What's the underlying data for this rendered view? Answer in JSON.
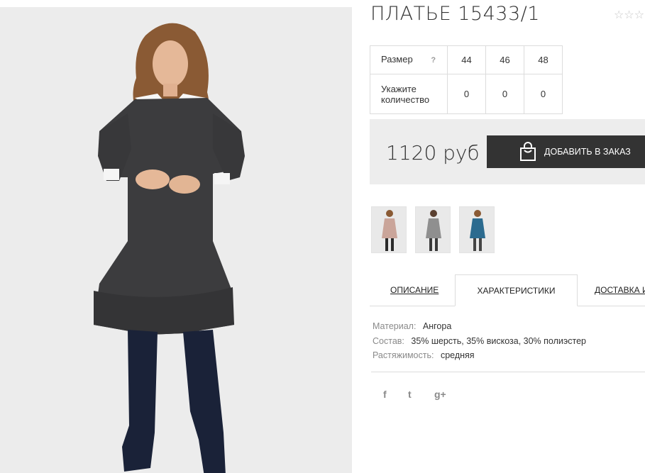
{
  "product": {
    "title": "ПЛАТЬЕ 15433/1",
    "rating_stars": "☆☆☆"
  },
  "sizes": {
    "size_label": "Размер",
    "help_label": "?",
    "qty_label_line1": "Укажите",
    "qty_label_line2": "количество",
    "options": [
      {
        "size": "44",
        "qty": "0"
      },
      {
        "size": "46",
        "qty": "0"
      },
      {
        "size": "48",
        "qty": "0"
      }
    ]
  },
  "buy": {
    "price": "1120 руб",
    "order_button_label": "ДОБАВИТЬ В ЗАКАЗ",
    "button_color": "#333333",
    "panel_color": "#ededed"
  },
  "colors_variants": [
    {
      "name": "beige",
      "color": "#caa59a"
    },
    {
      "name": "grey",
      "color": "#8f8f8f"
    },
    {
      "name": "blue",
      "color": "#2c6b8f"
    }
  ],
  "tabs": {
    "description": "ОПИСАНИЕ",
    "characteristics": "ХАРАКТЕРИСТИКИ",
    "delivery": "ДОСТАВКА И"
  },
  "specs": {
    "material_key": "Материал:",
    "material_val": "Ангора",
    "composition_key": "Состав:",
    "composition_val": "35% шерсть, 35% вискоза, 30% полиэстер",
    "stretch_key": "Растяжимость:",
    "stretch_val": "средняя"
  },
  "social": {
    "facebook": "f",
    "twitter": "t",
    "google": "g+"
  }
}
